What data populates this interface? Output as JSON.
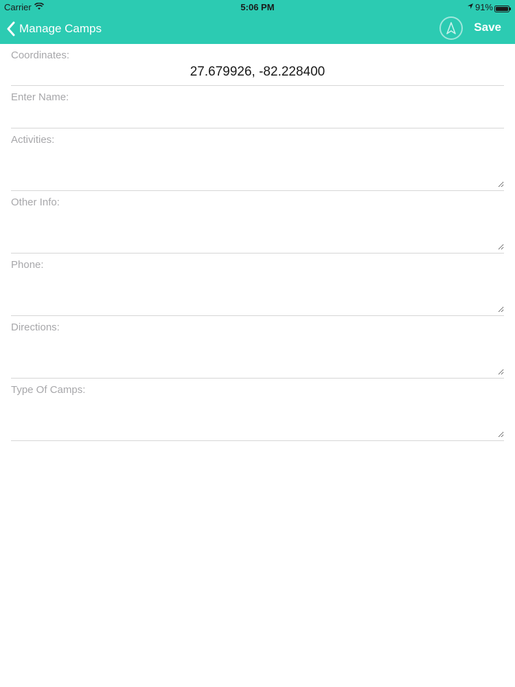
{
  "status_bar": {
    "carrier": "Carrier",
    "time": "5:06 PM",
    "battery": "91%"
  },
  "nav": {
    "back_label": "Manage Camps",
    "save_label": "Save",
    "compass_icon": "location-arrow-icon"
  },
  "form": {
    "coordinates_label": "Coordinates:",
    "coordinates_value": "27.679926, -82.228400",
    "name_label": "Enter Name:",
    "activities_label": "Activities:",
    "other_info_label": "Other Info:",
    "phone_label": "Phone:",
    "directions_label": "Directions:",
    "type_of_camps_label": "Type Of Camps:"
  },
  "colors": {
    "accent": "#2ccbb2",
    "label": "#a7a7aa",
    "divider": "#d6d6d6"
  }
}
